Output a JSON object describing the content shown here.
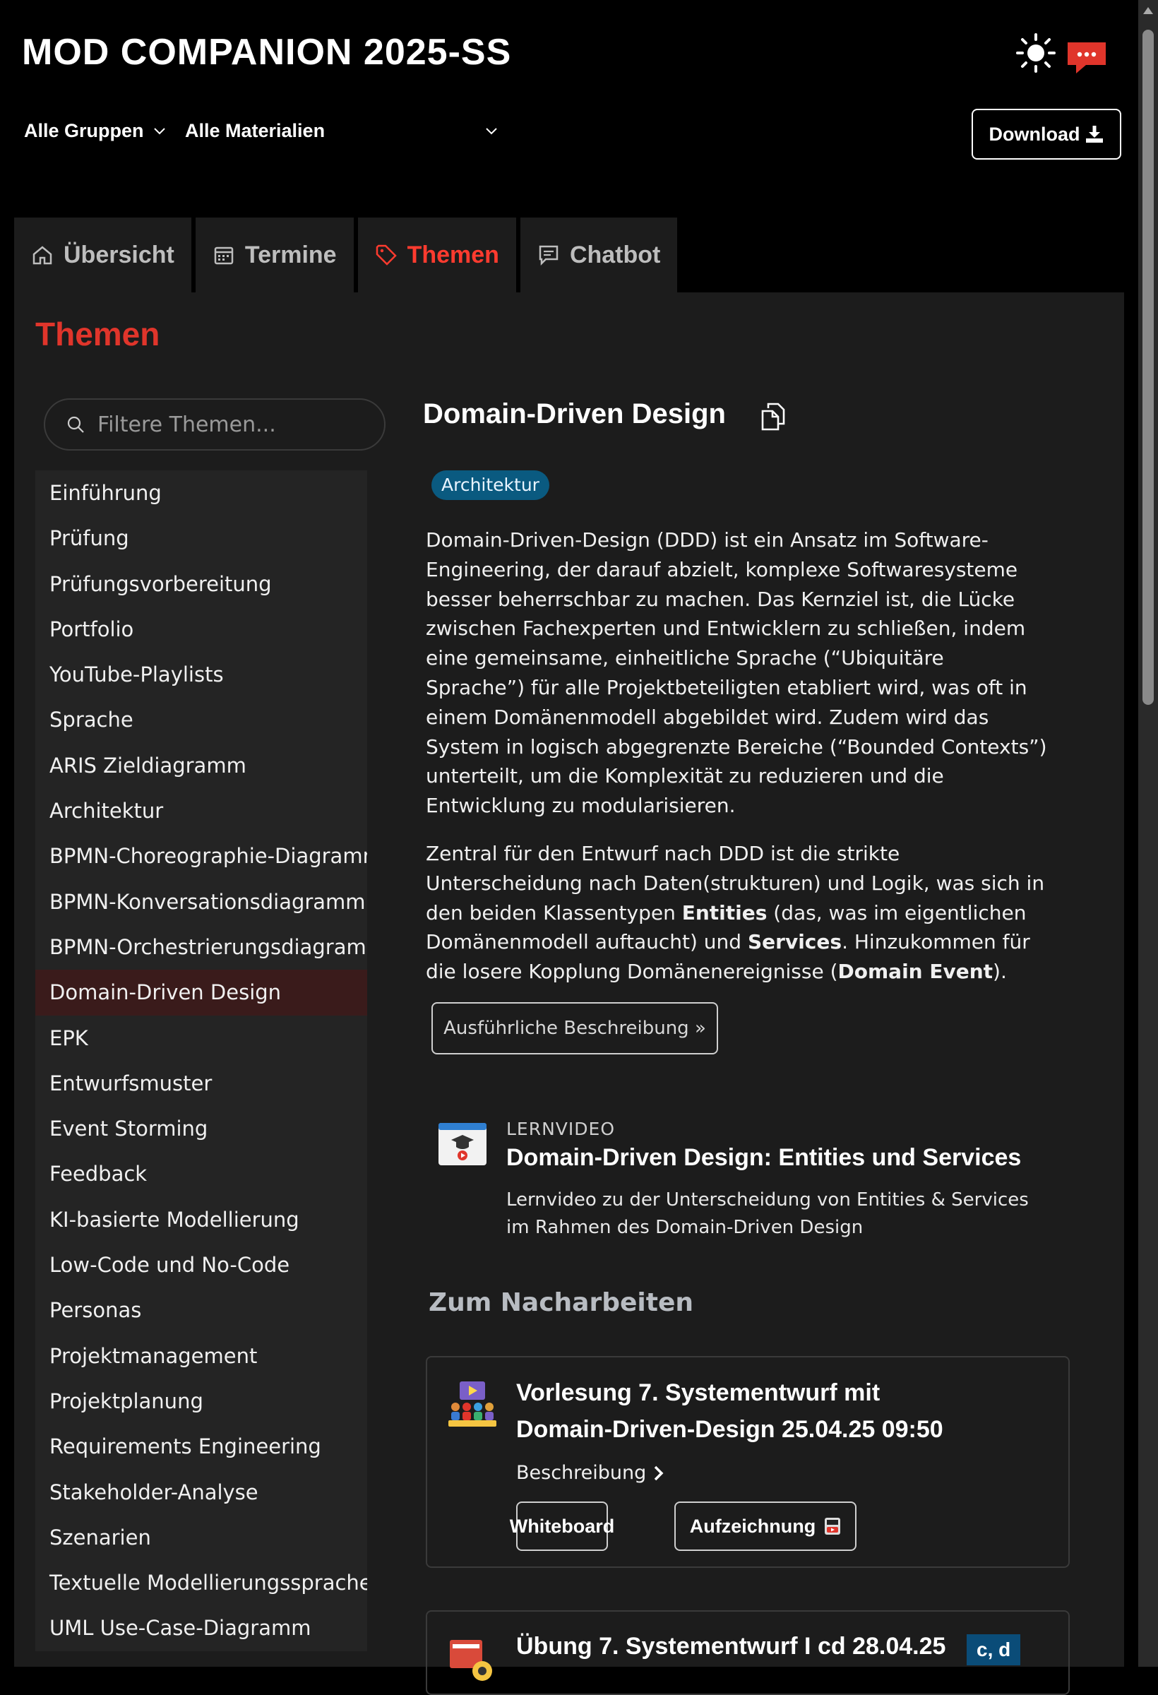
{
  "header": {
    "title": "MOD COMPANION 2025-SS",
    "filter_groups": "Alle Gruppen",
    "filter_materials": "Alle Materialien",
    "download_label": "Download",
    "chat_badge": "···"
  },
  "tabs": [
    {
      "label": "Übersicht",
      "icon": "home-icon",
      "active": false
    },
    {
      "label": "Termine",
      "icon": "calendar-icon",
      "active": false
    },
    {
      "label": "Themen",
      "icon": "tag-icon",
      "active": true
    },
    {
      "label": "Chatbot",
      "icon": "chat-icon",
      "active": false
    }
  ],
  "themen": {
    "section_title": "Themen",
    "search_placeholder": "Filtere Themen...",
    "topics": [
      "Einführung",
      "Prüfung",
      "Prüfungsvorbereitung",
      "Portfolio",
      "YouTube-Playlists",
      "Sprache",
      "ARIS Zieldiagramm",
      "Architektur",
      "BPMN-Choreographie-Diagramm",
      "BPMN-Konversationsdiagramm",
      "BPMN-Orchestrierungsdiagramm",
      "Domain-Driven Design",
      "EPK",
      "Entwurfsmuster",
      "Event Storming",
      "Feedback",
      "KI-basierte Modellierung",
      "Low-Code und No-Code",
      "Personas",
      "Projektmanagement",
      "Projektplanung",
      "Requirements Engineering",
      "Stakeholder-Analyse",
      "Szenarien",
      "Textuelle Modellierungssprachen",
      "UML Use-Case-Diagramm"
    ],
    "active_topic_index": 11
  },
  "topic": {
    "title": "Domain-Driven Design",
    "tag": "Architektur",
    "para1": "Domain-Driven-Design (DDD) ist ein Ansatz im Software-Engineering, der darauf abzielt, komplexe Softwaresysteme besser beherrschbar zu machen. Das Kernziel ist, die Lücke zwischen Fachexperten und Entwicklern zu schließen, indem eine gemeinsame, einheitliche Sprache (“Ubiquitäre Sprache”) für alle Projektbeteiligten etabliert wird, was oft in einem Domänenmodell abgebildet wird. Zudem wird das System in logisch abgegrenzte Bereiche (“Bounded Contexts”) unterteilt, um die Komplexität zu reduzieren und die Entwicklung zu modularisieren.",
    "para2_a": "Zentral für den Entwurf nach DDD ist die strikte Unterscheidung nach Daten(strukturen) und Logik, was sich in den beiden Klassentypen ",
    "para2_entities": "Entities",
    "para2_b": " (das, was im eigentlichen Domänenmodell auftaucht) und ",
    "para2_services": "Services",
    "para2_c": ". Hinzukommen für die losere Kopplung Domänenereignisse (",
    "para2_event": "Domain Event",
    "para2_d": ").",
    "more_button": "Ausführliche Beschreibung »"
  },
  "video": {
    "kicker": "LERNVIDEO",
    "title": "Domain-Driven Design: Entities und Services",
    "description": "Lernvideo zu der Unterscheidung von Entities & Services im Rahmen des Domain-Driven Design"
  },
  "nacharbeiten": {
    "heading": "Zum Nacharbeiten",
    "card1": {
      "title": "Vorlesung 7. Systementwurf mit Domain-Driven-Design 25.04.25 09:50",
      "beschreibung": "Beschreibung",
      "btn_whiteboard": "Whiteboard",
      "btn_aufzeichnung": "Aufzeichnung"
    },
    "card2": {
      "title": "Übung 7. Systementwurf I cd 28.04.25",
      "badge": "c, d"
    }
  },
  "colors": {
    "accent": "#e0352b",
    "tag_bg": "#0a5a80",
    "panel_bg": "#1c1c1c",
    "badge_bg": "#0a4c78"
  }
}
